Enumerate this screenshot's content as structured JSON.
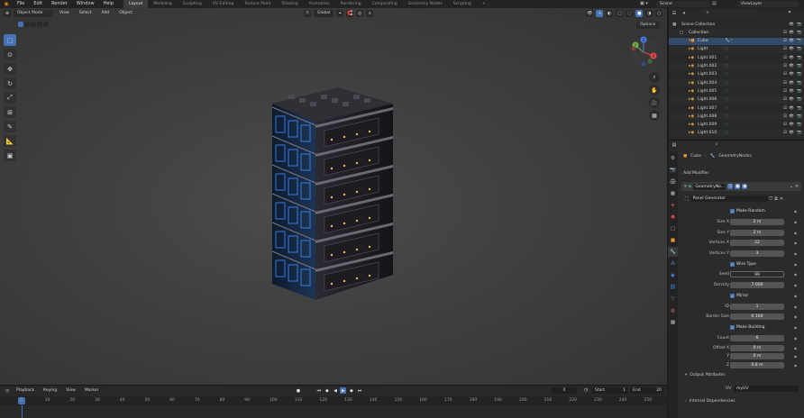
{
  "topbar": {
    "menus": [
      "File",
      "Edit",
      "Render",
      "Window",
      "Help"
    ],
    "workspaces": [
      "Layout",
      "Modeling",
      "Sculpting",
      "UV Editing",
      "Texture Paint",
      "Shading",
      "Animation",
      "Rendering",
      "Compositing",
      "Geometry Nodes",
      "Scripting"
    ],
    "active_workspace": "Layout",
    "scene": "Scene",
    "view_layer": "ViewLayer"
  },
  "viewport": {
    "mode": "Object Mode",
    "menus": [
      "View",
      "Select",
      "Add",
      "Object"
    ],
    "transform_orientation": "Global",
    "options_label": "Options",
    "gizmo": {
      "x": "X",
      "y": "Y",
      "z": "Z"
    }
  },
  "outliner": {
    "root": "Scene Collection",
    "collection": "Collection",
    "items": [
      "Cube",
      "Light",
      "Light.001",
      "Light.002",
      "Light.003",
      "Light.004",
      "Light.005",
      "Light.006",
      "Light.007",
      "Light.008",
      "Light.009",
      "Light.010"
    ]
  },
  "properties": {
    "breadcrumb_object": "Cube",
    "breadcrumb_modifier": "GeometryNodes",
    "add_modifier": "Add Modifier",
    "modifier_name": "GeometryNo...",
    "node_group": "Panel Generator",
    "fields": {
      "make_random": "Make Random",
      "size_x_label": "Size X",
      "size_x": "2 m",
      "size_y_label": "Size Y",
      "size_y": "2 m",
      "vertices_x_label": "Vertices X",
      "vertices_x": "22",
      "vertices_y_label": "Vertices Y",
      "vertices_y": "3",
      "wire_type": "Wire Type",
      "seed_label": "Seed",
      "seed": "99",
      "density_label": "Density",
      "density": "7.000",
      "mirror": "Mirror",
      "id_label": "ID",
      "id": "1",
      "border_size_label": "Border Size",
      "border_size": "0.160",
      "make_building": "Make Building",
      "count_label": "Count",
      "count": "6",
      "offset_x_label": "Offset X",
      "offset_x": "0 m",
      "y_label": "Y",
      "offset_y": "0 m",
      "z_label": "Z",
      "offset_z": "0.8 m"
    },
    "output_attributes": "Output Attributes",
    "uv_label": "UV",
    "uv_value": "myUV",
    "internal_dependencies": "Internal Dependencies"
  },
  "timeline": {
    "menus": [
      "Playback",
      "Keying",
      "View",
      "Marker"
    ],
    "current_frame": "0",
    "start_label": "Start",
    "start": "1",
    "end_label": "End",
    "end": "20",
    "ticks": [
      "0",
      "10",
      "20",
      "30",
      "40",
      "50",
      "60",
      "70",
      "80",
      "90",
      "100",
      "110",
      "120",
      "130",
      "140",
      "150",
      "160",
      "170",
      "180",
      "190",
      "200",
      "210",
      "220",
      "230",
      "240",
      "250"
    ]
  },
  "colors": {
    "accent": "#4772b3",
    "glow": "#3a8dff",
    "warm": "#ffb24a"
  }
}
